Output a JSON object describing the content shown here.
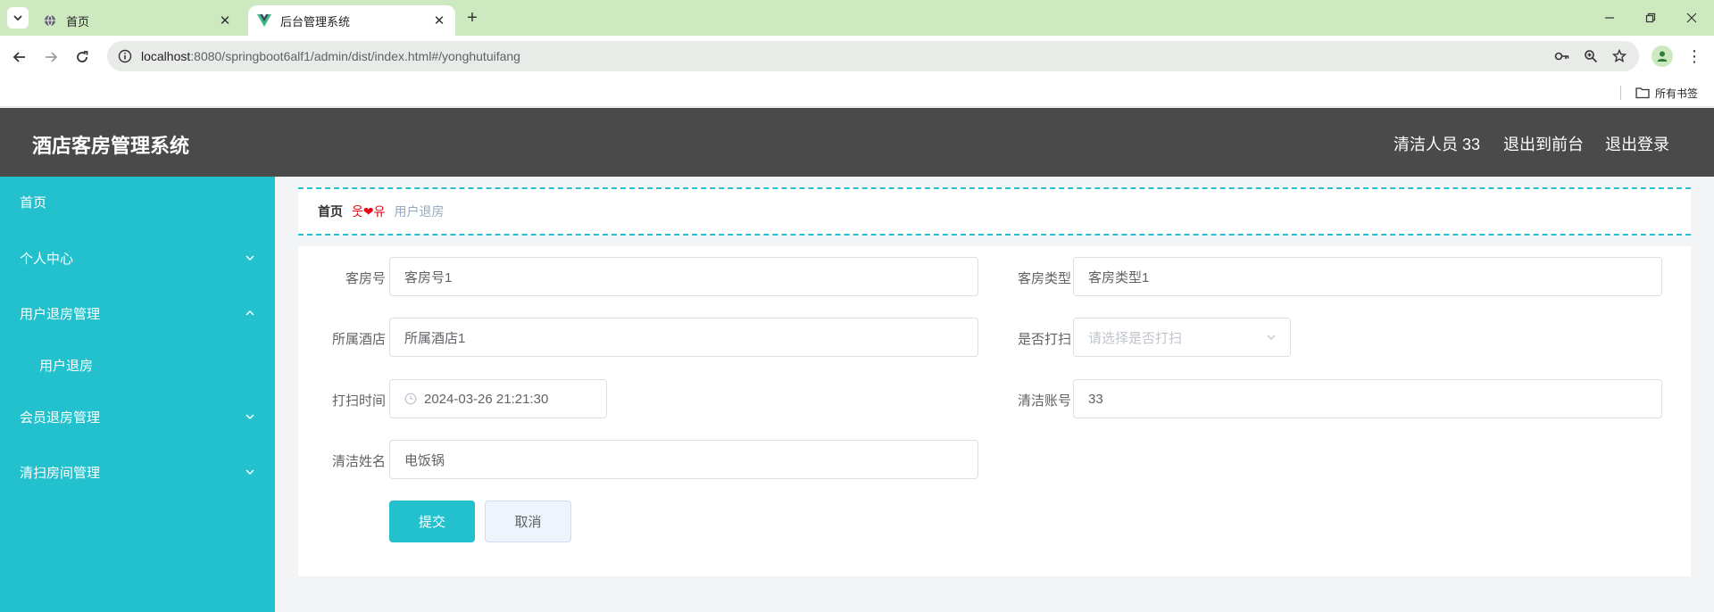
{
  "browser": {
    "tabs": [
      {
        "title": "首页"
      },
      {
        "title": "后台管理系统"
      }
    ],
    "url_host": "localhost",
    "url_rest": ":8080/springboot6alf1/admin/dist/index.html#/yonghutuifang",
    "bookmarks_label": "所有书签"
  },
  "header": {
    "title": "酒店客房管理系统",
    "user": "清洁人员 33",
    "exit_front": "退出到前台",
    "logout": "退出登录"
  },
  "sidebar": {
    "items": [
      {
        "label": "首页"
      },
      {
        "label": "个人中心"
      },
      {
        "label": "用户退房管理"
      },
      {
        "label": "用户退房"
      },
      {
        "label": "会员退房管理"
      },
      {
        "label": "清扫房间管理"
      }
    ]
  },
  "breadcrumb": {
    "home": "首页",
    "separator": "웃❤유",
    "current": "用户退房"
  },
  "form": {
    "room_no": {
      "label": "客房号",
      "value": "客房号1"
    },
    "room_type": {
      "label": "客房类型",
      "value": "客房类型1"
    },
    "hotel": {
      "label": "所属酒店",
      "value": "所属酒店1"
    },
    "cleaned": {
      "label": "是否打扫",
      "placeholder": "请选择是否打扫"
    },
    "clean_time": {
      "label": "打扫时间",
      "value": "2024-03-26 21:21:30"
    },
    "clean_account": {
      "label": "清洁账号",
      "value": "33"
    },
    "clean_name": {
      "label": "清洁姓名",
      "value": "电饭锅"
    },
    "submit": "提交",
    "cancel": "取消"
  },
  "colors": {
    "accent": "#22c1cd",
    "header_bg": "#4a4a4a",
    "tabstrip_bg": "#cde9c0"
  }
}
